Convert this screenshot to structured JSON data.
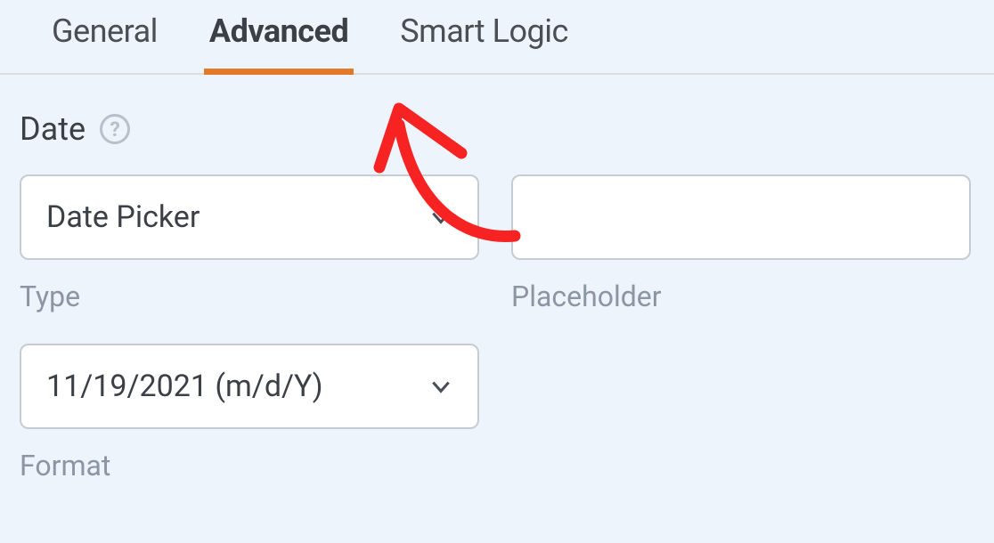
{
  "tabs": {
    "general": "General",
    "advanced": "Advanced",
    "smart_logic": "Smart Logic"
  },
  "section": {
    "title": "Date",
    "help_tooltip": "?"
  },
  "fields": {
    "type": {
      "label": "Type",
      "selected": "Date Picker"
    },
    "placeholder": {
      "label": "Placeholder",
      "value": ""
    },
    "format": {
      "label": "Format",
      "selected": "11/19/2021 (m/d/Y)"
    }
  }
}
